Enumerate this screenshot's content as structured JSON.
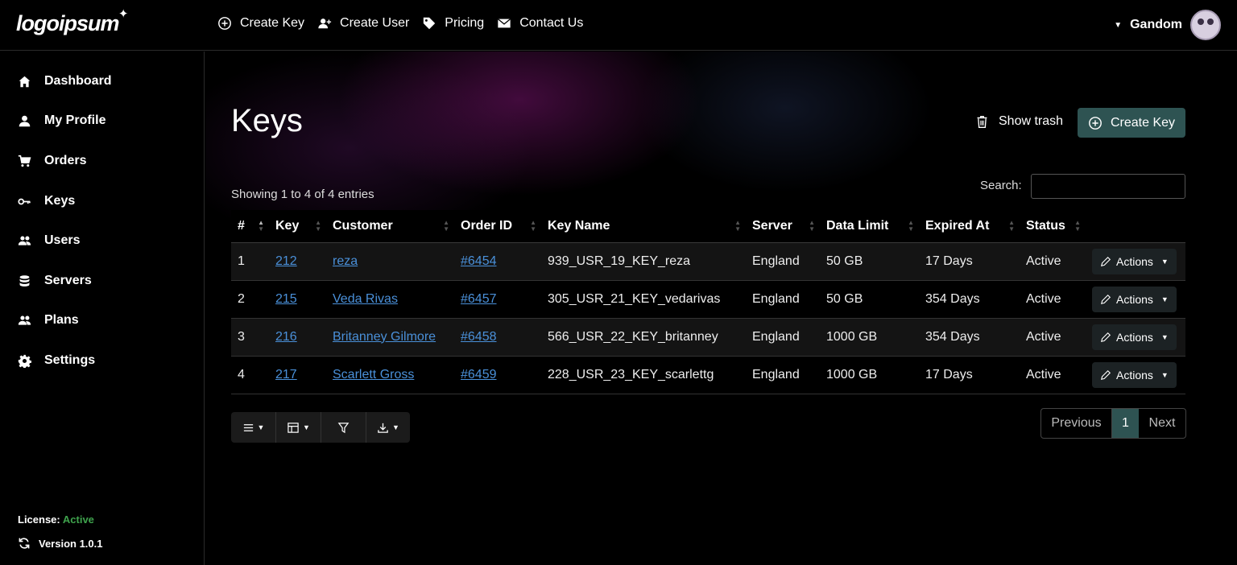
{
  "app": {
    "logo_text": "logoipsum",
    "user_name": "Gandom"
  },
  "topnav": [
    {
      "label": "Create Key",
      "icon": "plus-circle-icon"
    },
    {
      "label": "Create User",
      "icon": "user-plus-icon"
    },
    {
      "label": "Pricing",
      "icon": "tag-icon"
    },
    {
      "label": "Contact Us",
      "icon": "envelope-icon"
    }
  ],
  "sidebar": {
    "items": [
      {
        "label": "Dashboard",
        "icon": "home-icon"
      },
      {
        "label": "My Profile",
        "icon": "user-icon"
      },
      {
        "label": "Orders",
        "icon": "cart-icon"
      },
      {
        "label": "Keys",
        "icon": "key-icon"
      },
      {
        "label": "Users",
        "icon": "users-icon"
      },
      {
        "label": "Servers",
        "icon": "database-icon"
      },
      {
        "label": "Plans",
        "icon": "users-icon"
      },
      {
        "label": "Settings",
        "icon": "gear-icon"
      }
    ],
    "license_label": "License:",
    "license_status": "Active",
    "version": "Version 1.0.1"
  },
  "page": {
    "title": "Keys",
    "show_trash": "Show trash",
    "create_key": "Create Key",
    "showing": "Showing 1 to 4 of 4 entries",
    "search_label": "Search:",
    "search_value": ""
  },
  "table": {
    "columns": [
      "#",
      "Key",
      "Customer",
      "Order ID",
      "Key Name",
      "Server",
      "Data Limit",
      "Expired At",
      "Status"
    ],
    "rows": [
      {
        "num": "1",
        "key": "212",
        "customer": "reza",
        "order": "#6454",
        "key_name": "939_USR_19_KEY_reza",
        "server": "England",
        "data_limit": "50 GB",
        "expired": "17 Days",
        "status": "Active",
        "action": "Actions"
      },
      {
        "num": "2",
        "key": "215",
        "customer": "Veda Rivas",
        "order": "#6457",
        "key_name": "305_USR_21_KEY_vedarivas",
        "server": "England",
        "data_limit": "50 GB",
        "expired": "354 Days",
        "status": "Active",
        "action": "Actions"
      },
      {
        "num": "3",
        "key": "216",
        "customer": "Britanney Gilmore",
        "order": "#6458",
        "key_name": "566_USR_22_KEY_britanney",
        "server": "England",
        "data_limit": "1000 GB",
        "expired": "354 Days",
        "status": "Active",
        "action": "Actions"
      },
      {
        "num": "4",
        "key": "217",
        "customer": "Scarlett Gross",
        "order": "#6459",
        "key_name": "228_USR_23_KEY_scarlettg",
        "server": "England",
        "data_limit": "1000 GB",
        "expired": "17 Days",
        "status": "Active",
        "action": "Actions"
      }
    ]
  },
  "pager": {
    "previous": "Previous",
    "current": "1",
    "next": "Next"
  },
  "colors": {
    "accent": "#2e5352",
    "link": "#4a90d9",
    "license_ok": "#3fa34d"
  }
}
